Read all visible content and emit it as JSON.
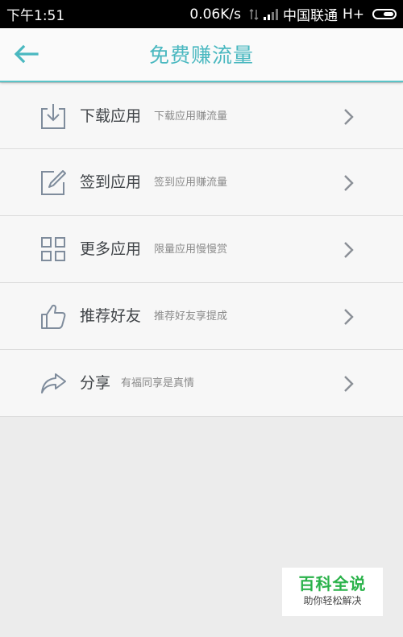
{
  "status_bar": {
    "time": "下午1:51",
    "speed": "0.06K/s",
    "carrier": "中国联通",
    "network": "H+"
  },
  "header": {
    "title": "免费赚流量",
    "back_icon": "back-arrow-icon"
  },
  "menu": {
    "items": [
      {
        "icon": "download-icon",
        "title": "下载应用",
        "subtitle": "下载应用赚流量"
      },
      {
        "icon": "edit-icon",
        "title": "签到应用",
        "subtitle": "签到应用赚流量"
      },
      {
        "icon": "grid-icon",
        "title": "更多应用",
        "subtitle": "限量应用慢慢赏"
      },
      {
        "icon": "thumbs-up-icon",
        "title": "推荐好友",
        "subtitle": "推荐好友享提成"
      },
      {
        "icon": "share-icon",
        "title": "分享",
        "subtitle": "有福同享是真情"
      }
    ]
  },
  "watermark": {
    "main": "百科全说",
    "sub": "助你轻松解决"
  },
  "colors": {
    "accent": "#4ab8c0",
    "status_bar_bg": "#000000",
    "list_bg": "#f7f7f7",
    "page_bg": "#ececec",
    "icon_stroke": "#7f8c9c",
    "watermark_green": "#2ab24a"
  }
}
